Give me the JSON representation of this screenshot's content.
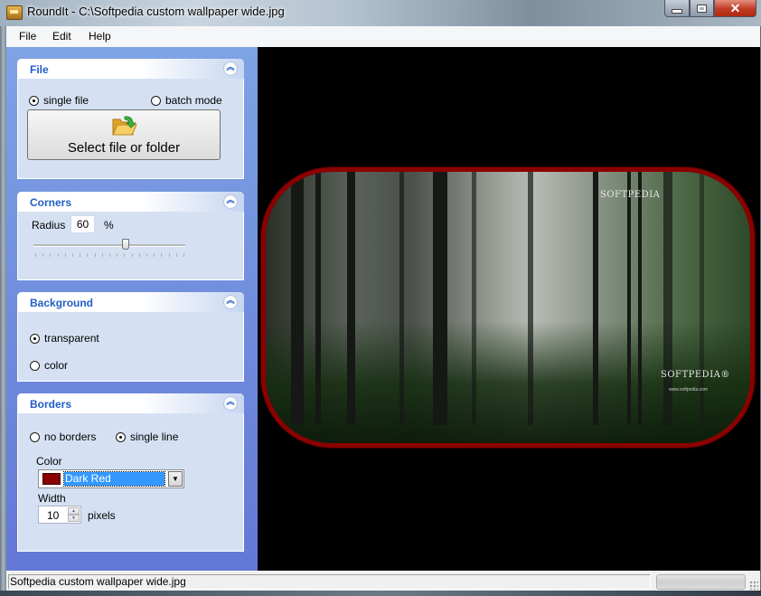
{
  "window": {
    "title": "RoundIt - C:\\Softpedia custom wallpaper wide.jpg",
    "controls": {
      "minimize": "minimize",
      "maximize": "maximize",
      "close": "✕"
    }
  },
  "menu": {
    "items": [
      "File",
      "Edit",
      "Help"
    ]
  },
  "panels": {
    "file": {
      "title": "File",
      "collapse_glyph": "︽",
      "mode_options": [
        {
          "label": "single file",
          "selected": true
        },
        {
          "label": "batch mode",
          "selected": false
        }
      ],
      "select_button_label": "Select file or folder",
      "watermark": "SOFTPEDIA"
    },
    "corners": {
      "title": "Corners",
      "collapse_glyph": "︽",
      "radius_label": "Radius",
      "radius_value": "60",
      "radius_unit": "%",
      "slider_fraction": 0.6
    },
    "background": {
      "title": "Background",
      "collapse_glyph": "︽",
      "options": [
        {
          "label": "transparent",
          "selected": true
        },
        {
          "label": "color",
          "selected": false
        }
      ]
    },
    "borders": {
      "title": "Borders",
      "collapse_glyph": "︽",
      "options": [
        {
          "label": "no borders",
          "selected": false
        },
        {
          "label": "single line",
          "selected": true
        }
      ],
      "color_label": "Color",
      "color_value": "Dark Red",
      "color_hex": "#8b0000",
      "dropdown_glyph": "▼",
      "width_label": "Width",
      "width_value": "10",
      "width_unit": "pixels",
      "spin_up": "▲",
      "spin_down": "▼"
    }
  },
  "preview": {
    "watermark_top": "SOFTPEDIA",
    "watermark_bottom": "SOFTPEDIA®",
    "watermark_url": "www.softpedia.com",
    "border_color": "#8b0000"
  },
  "status": {
    "filename": "Softpedia custom wallpaper wide.jpg",
    "progress_fraction": 0
  }
}
